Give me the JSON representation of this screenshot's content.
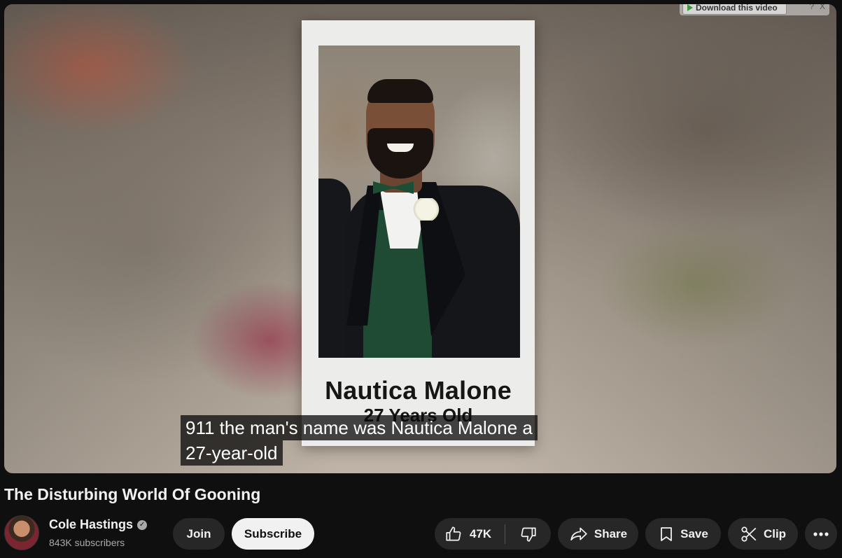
{
  "player": {
    "download_bar": {
      "label": "Download this video",
      "help": "?",
      "close": "X"
    },
    "card": {
      "name": "Nautica Malone",
      "age": "27 Years Old"
    },
    "captions": [
      "911 the man's name was Nautica Malone a",
      "27-year-old"
    ]
  },
  "video": {
    "title": "The Disturbing World Of Gooning"
  },
  "channel": {
    "name": "Cole Hastings",
    "verified": "✓",
    "subscribers": "843K subscribers"
  },
  "actions": {
    "join": "Join",
    "subscribe": "Subscribe",
    "likes": "47K",
    "share": "Share",
    "save": "Save",
    "clip": "Clip"
  },
  "icons": {
    "like": "thumbs-up-icon",
    "dislike": "thumbs-down-icon",
    "share": "share-arrow-icon",
    "save": "bookmark-icon",
    "clip": "scissors-icon",
    "more": "more-horizontal-icon"
  }
}
